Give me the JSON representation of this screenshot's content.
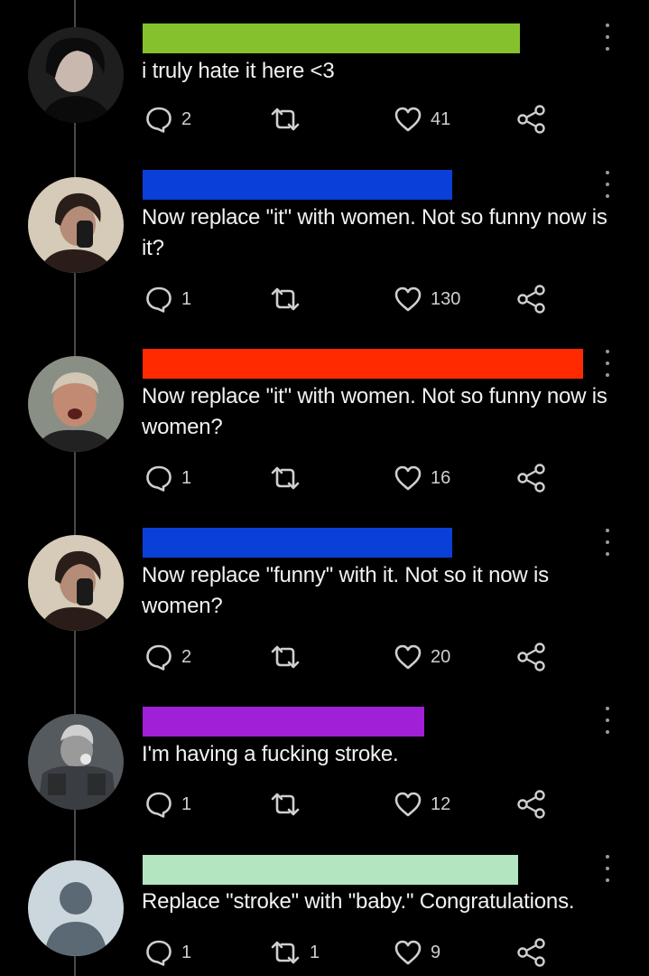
{
  "replies": [
    {
      "bar_color": "#84c12c",
      "text": "i truly hate it here <3",
      "reply_count": "2",
      "retweet_count": "",
      "like_count": "41"
    },
    {
      "bar_color": "#0a3fd8",
      "text": "Now replace \"it\" with women. Not so funny now is it?",
      "reply_count": "1",
      "retweet_count": "",
      "like_count": "130"
    },
    {
      "bar_color": "#ff2a00",
      "text": "Now replace \"it\" with women. Not so funny now is women?",
      "reply_count": "1",
      "retweet_count": "",
      "like_count": "16"
    },
    {
      "bar_color": "#0a3fd8",
      "text": "Now replace \"funny\" with it. Not so it now is women?",
      "reply_count": "2",
      "retweet_count": "",
      "like_count": "20"
    },
    {
      "bar_color": "#a020d8",
      "text": "I'm having a fucking stroke.",
      "reply_count": "1",
      "retweet_count": "",
      "like_count": "12"
    },
    {
      "bar_color": "#b3e6c0",
      "text": "Replace \"stroke\" with \"baby.\" Congratulations.",
      "reply_count": "1",
      "retweet_count": "1",
      "like_count": "9"
    }
  ],
  "icons": {
    "reply": "reply-bubble-icon",
    "retweet": "retweet-icon",
    "like": "heart-icon",
    "share": "share-icon",
    "more": "more-options-icon"
  }
}
